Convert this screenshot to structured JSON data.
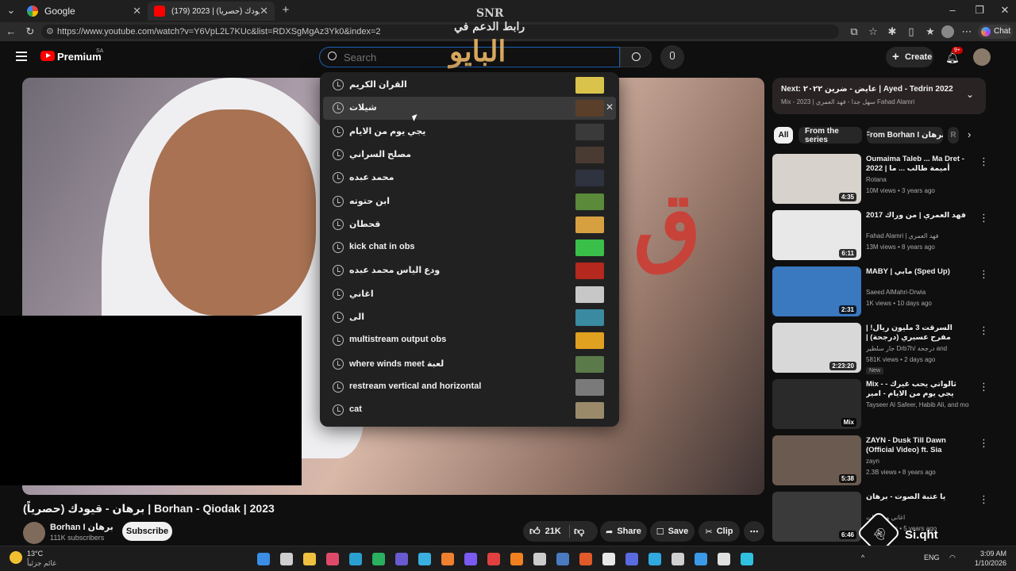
{
  "browser": {
    "tabs": [
      {
        "title": "Google"
      },
      {
        "title": "(179) برهان - قيودك (حصرياً) | 2023"
      }
    ],
    "new_tab": "+",
    "url": "https://www.youtube.com/watch?v=Y6VpL2L7KUc&list=RDXSgMgAz3Yk0&index=2",
    "chat_label": "Chat"
  },
  "header": {
    "logo_text": "Premium",
    "region": "SA",
    "search_placeholder": "Search",
    "create_label": "Create",
    "notif_badge": "9+"
  },
  "watermark": {
    "top_logo": "SNR",
    "line1": "رابط الدعم في",
    "line2": "البايو"
  },
  "suggestions": [
    {
      "text": "القران الكريم",
      "thumb": "#d9c34a"
    },
    {
      "text": "شيلات",
      "thumb": "#5a3f2a",
      "hover": true
    },
    {
      "text": "يجي يوم من الايام",
      "thumb": "#3a3a3a"
    },
    {
      "text": "مصلح السراني",
      "thumb": "#4a3b32"
    },
    {
      "text": "محمد عبده",
      "thumb": "#2f3340"
    },
    {
      "text": "ابن حتوته",
      "thumb": "#5a8a3a"
    },
    {
      "text": "قحطان",
      "thumb": "#d6a040"
    },
    {
      "text": "kick chat in obs",
      "thumb": "#3ac04a"
    },
    {
      "text": "ودع الياس محمد عبده",
      "thumb": "#b4281e"
    },
    {
      "text": "اغاني",
      "thumb": "#c7c7c7"
    },
    {
      "text": "الى",
      "thumb": "#3a8aa0"
    },
    {
      "text": "multistream output obs",
      "thumb": "#e0a020"
    },
    {
      "text": "where winds meet لعبة",
      "thumb": "#5a7a4a"
    },
    {
      "text": "restream vertical and horizontal",
      "thumb": "#7a7a7a"
    },
    {
      "text": "cat",
      "thumb": "#9a8a6a"
    }
  ],
  "video": {
    "title": "برهان - قيودك (حصرياً) | Borhan - Qiodak | 2023",
    "channel": "Borhan I برهان",
    "subscribers": "111K subscribers",
    "subscribe_label": "Subscribe",
    "likes": "21K",
    "share_label": "Share",
    "save_label": "Save",
    "clip_label": "Clip"
  },
  "up_next": {
    "title": "Next: عايض - ضرين ٢٠٢٢ | Ayed - Tedrin 2022",
    "sub": "Mix - سهل جداً - فهد العمري | 2023 Fahad Alamri"
  },
  "chips": [
    "All",
    "From the series",
    "From Borhan I برهان",
    "R"
  ],
  "recommendations": [
    {
      "title": "Oumaima Taleb ... Ma Dret - 2022 | أميمة طالب ... ما دريت",
      "channel": "Rotana",
      "meta": "10M views • 3 years ago",
      "duration": "4:35",
      "color": "#d7d2cc"
    },
    {
      "title": "فهد العمري | من وراك 2017",
      "channel": "Fahad Alamri | فهد العمري",
      "meta": "13M views • 8 years ago",
      "duration": "6:11",
      "color": "#e8e8e8"
    },
    {
      "title": "MABY | مابي (Sped Up)",
      "channel": "Saeed AlMahri-Drwia",
      "meta": "1K views • 10 days ago",
      "duration": "2:31",
      "color": "#3a78c0"
    },
    {
      "title": "السرقت 3 مليون ريال! | مفرح عسيري (درجحة) | بودكاست يسير خير",
      "channel": "جار سلطير Drb7h/ درجحة and",
      "meta": "581K views • 2 days ago",
      "duration": "2:23:20",
      "badge": "New",
      "color": "#d8d8d8"
    },
    {
      "title": "Mix - ثالواتي يحب غيرك - يجي يوم من الايام - امير عسلام | جديد",
      "channel": "Tayseer Al Safeer, Habib Ali, and more",
      "meta": "",
      "duration": "Mix",
      "color": "#2a2a2a"
    },
    {
      "title": "ZAYN - Dusk Till Dawn (Official Video) ft. Sia",
      "channel": "zayn",
      "meta": "2.3B views • 8 years ago",
      "duration": "5:38",
      "color": "#6a5a50"
    },
    {
      "title": "يا عتبة الصوت - برهان",
      "channel": "اغاني وطربيات",
      "meta": "2.6M views • 5 years ago",
      "duration": "6:46",
      "color": "#3a3a3a"
    }
  ],
  "overlay_brand": "Si.qht",
  "taskbar": {
    "weather_temp": "13°C",
    "weather_desc": "غائم جزئياً",
    "lang": "ENG",
    "time": "3:09 AM",
    "date": "1/10/2026"
  }
}
